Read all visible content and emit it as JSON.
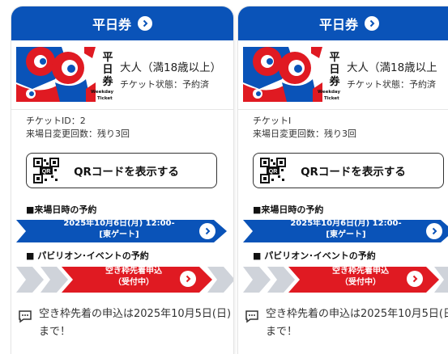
{
  "colors": {
    "header_blue": "#0a53b8",
    "reserve_red": "#e01a22",
    "arrow_gray": "#cfd3da"
  },
  "cards": [
    {
      "header_title": "平日券",
      "art_text": "平日券",
      "art_sub1": "Weekday",
      "art_sub2": "Ticket",
      "ticket_type": "大人（満18歳以上）",
      "ticket_status": "チケット状態：予約済",
      "ticket_id": "チケットID：2",
      "change_count": "来場日変更回数：残り3回",
      "qr_button": "QRコードを表示する",
      "qr_icon_label": "QR",
      "visit_section": "■来場日時の予約",
      "visit_datetime": "2025年10月6日(月) 12:00-",
      "visit_gate": "[東ゲート]",
      "pavilion_section": "■ パビリオン･イベントの予約",
      "pavilion_btn_line1": "空き枠先着申込",
      "pavilion_btn_line2": "（受付中）",
      "notice": "空き枠先着の申込は2025年10月5日(日)まで！"
    },
    {
      "header_title": "平日券",
      "art_text": "平日券",
      "art_sub1": "Weekday",
      "art_sub2": "Ticket",
      "ticket_type": "大人（満18歳以上",
      "ticket_status": "チケット状態：予約済",
      "ticket_id": "チケットI",
      "change_count": "来場日変更回数：残り3回",
      "qr_button": "QRコードを表示する",
      "qr_icon_label": "QR",
      "visit_section": "■来場日時の予約",
      "visit_datetime": "2025年10月6日(月) 12:00-",
      "visit_gate": "[東ゲート]",
      "pavilion_section": "■ パビリオン･イベントの予約",
      "pavilion_btn_line1": "空き枠先着申込",
      "pavilion_btn_line2": "（受付中）",
      "notice": "空き枠先着の申込は2025年10月5日(日)まで！"
    }
  ]
}
